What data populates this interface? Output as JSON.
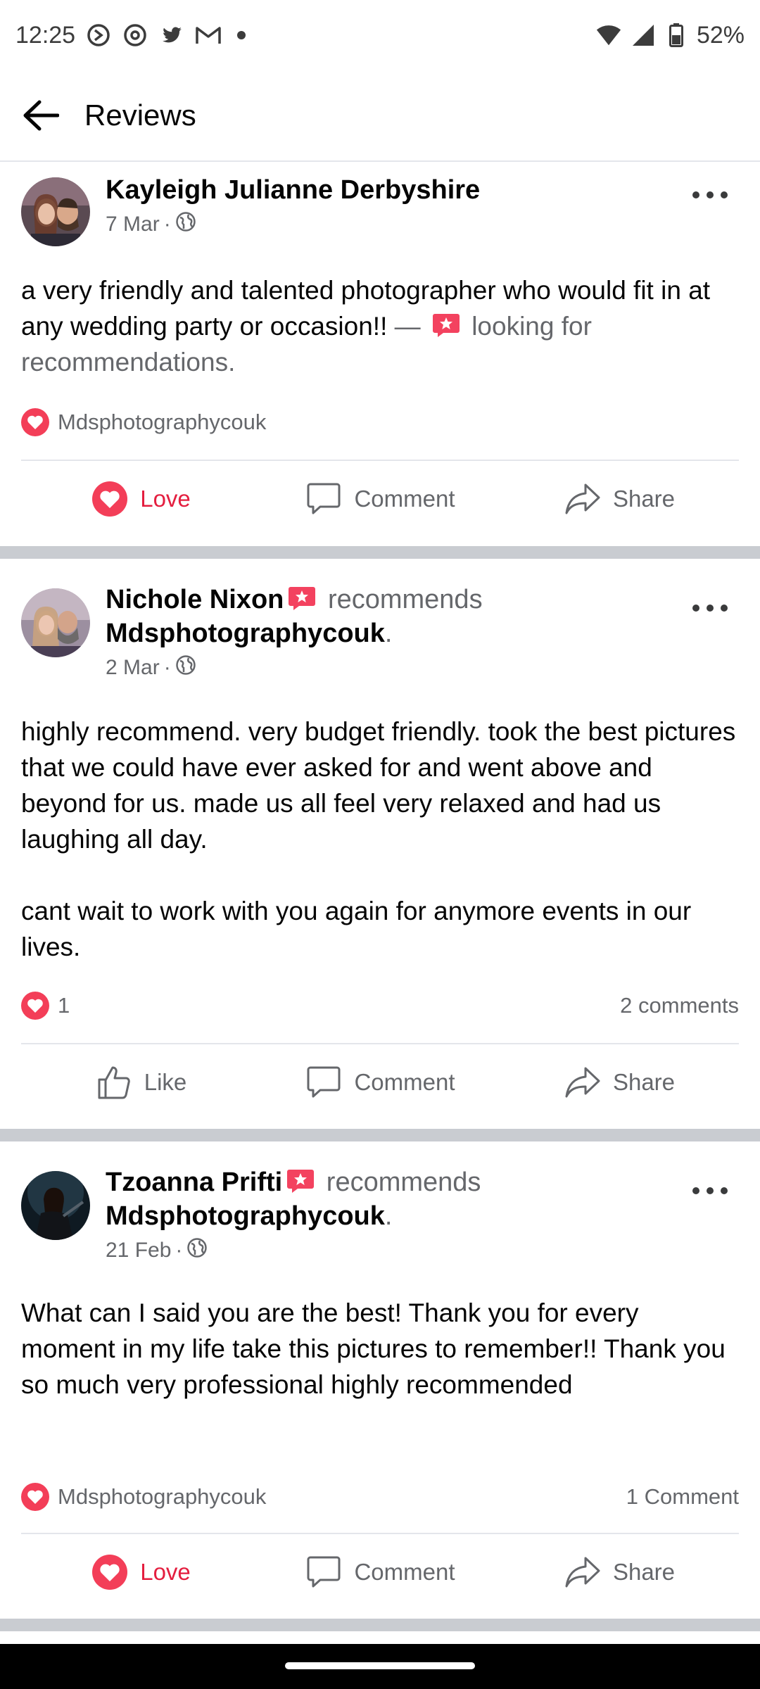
{
  "status_bar": {
    "time": "12:25",
    "icons": [
      "whatsapp-icon",
      "threads-icon",
      "twitter-icon",
      "gmail-icon",
      "notification-dot-icon"
    ],
    "right_icons": [
      "wifi-icon",
      "cell-signal-icon",
      "battery-icon"
    ],
    "battery": "52%"
  },
  "app_bar": {
    "title": "Reviews",
    "back_icon": "back-arrow-icon"
  },
  "posts": [
    {
      "author": "Kayleigh Julianne Derbyshire",
      "recommends_text": "",
      "page": "",
      "date": "7 Mar",
      "privacy_icon": "globe-icon",
      "body": "a very friendly and talented photographer who would fit in at any wedding party or occasion!!",
      "activity_prefix": "—",
      "activity": "looking for recommendations.",
      "reaction_text": "Mdsphotographycouk",
      "comment_count": "",
      "actions": {
        "react": "Love",
        "comment": "Comment",
        "share": "Share"
      },
      "react_state": "love"
    },
    {
      "author": "Nichole Nixon",
      "recommends_text": "recommends",
      "page": "Mdsphotographycouk",
      "date": "2 Mar",
      "privacy_icon": "globe-icon",
      "body_paragraphs": [
        "highly recommend. very budget friendly. took the best pictures that we could have ever asked for and went above and beyond for us. made us all feel very relaxed and had us laughing all day.",
        "cant wait to work with you again for anymore events in our lives."
      ],
      "reaction_text": "1",
      "comment_count": "2 comments",
      "actions": {
        "react": "Like",
        "comment": "Comment",
        "share": "Share"
      },
      "react_state": "like"
    },
    {
      "author": "Tzoanna Prifti",
      "recommends_text": "recommends",
      "page": "Mdsphotographycouk",
      "date": "21 Feb",
      "privacy_icon": "globe-icon",
      "body": "What can I said you are the best! Thank you for every moment in my life take this pictures to remember!! Thank you so much very professional highly recommended",
      "reaction_text": "Mdsphotographycouk",
      "comment_count": "1 Comment",
      "actions": {
        "react": "Love",
        "comment": "Comment",
        "share": "Share"
      },
      "react_state": "love"
    }
  ],
  "colors": {
    "love": "#e41e3f",
    "secondary_text": "#65676b",
    "divider": "#c9ccd1",
    "recommend_badge": "#f3425f"
  }
}
